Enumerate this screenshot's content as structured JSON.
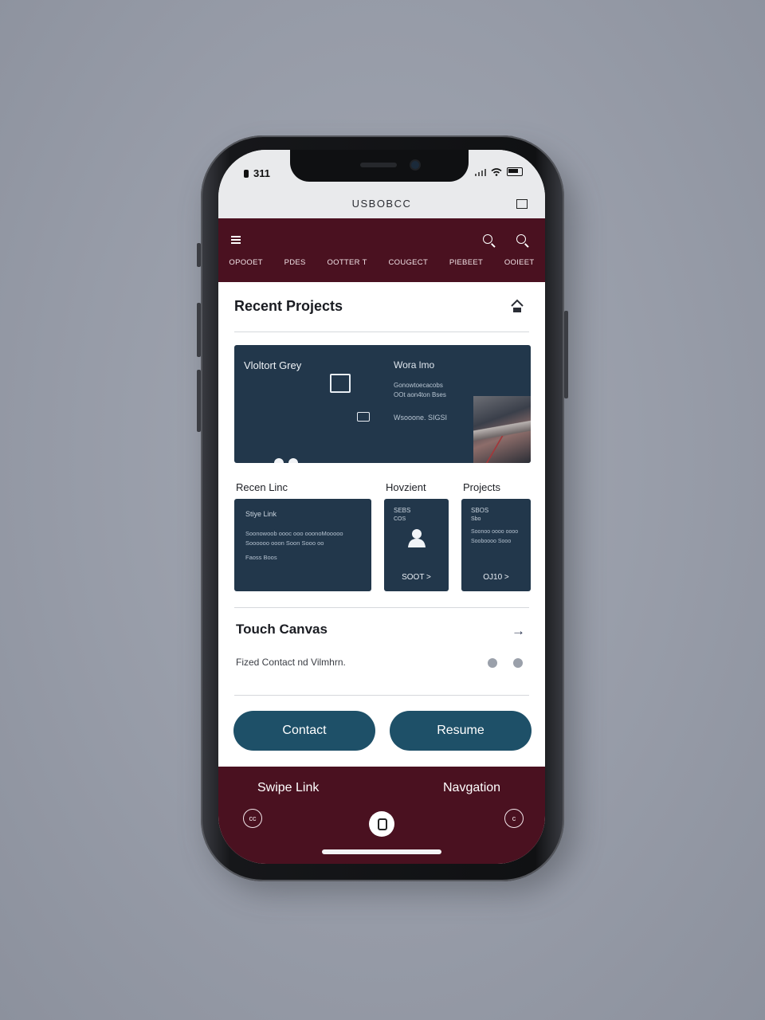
{
  "status": {
    "time": "311"
  },
  "app": {
    "title": "USBOBCC"
  },
  "topnav": {
    "tabs": [
      "OPOOET",
      "PDES",
      "OOTTER T",
      "COUGECT",
      "PIEBEET",
      "OOIEET"
    ]
  },
  "recent": {
    "title": "Recent Projects"
  },
  "hero": {
    "title": "Vloltort Grey",
    "right_title": "Wora lmo",
    "lines": [
      "Gonowtoecacobs",
      "OOt aon4ton Bses",
      "Wsooone. SIGSI"
    ]
  },
  "labels": {
    "left": "Recen Linc",
    "middle": "Hovzient",
    "right": "Projects"
  },
  "cards": [
    {
      "title": "Stiye Link",
      "body": [
        "Soonowoob oooc ooo ooonoMooooo",
        "Soooooo ooon Soon Sooo oo"
      ],
      "foot": "Faoss Boos"
    },
    {
      "title": "SEBS",
      "sub": "COS",
      "cta": "SOOT >"
    },
    {
      "title": "SBOS",
      "sub": "Sbo",
      "body": [
        "Soonoo oooo oooo",
        "Sooboooo Sooo"
      ],
      "cta": "OJ10 >"
    }
  ],
  "touch": {
    "title": "Touch Canvas",
    "subtitle": "Fized Contact nd Vilmhrn."
  },
  "buttons": {
    "contact": "Contact",
    "resume": "Resume"
  },
  "bottom": {
    "left_label": "Swipe Link",
    "right_label": "Navgation",
    "left_icon_text": "cc",
    "right_icon_text": "c"
  }
}
